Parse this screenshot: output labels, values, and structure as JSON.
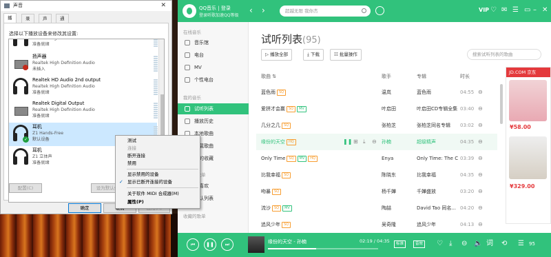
{
  "sound_dialog": {
    "title": "声音",
    "close": "✕",
    "tabs": [
      "播放",
      "录制",
      "声音",
      "通信"
    ],
    "hint": "选择以下播放设备来修改其设置:",
    "devices": [
      {
        "name": "",
        "sub": "Realtek High Definition Audio",
        "status": "准备就绪"
      },
      {
        "name": "扬声器",
        "sub": "Realtek High Definition Audio",
        "status": "未插入"
      },
      {
        "name": "Realtek HD Audio 2nd output",
        "sub": "Realtek High Definition Audio",
        "status": "准备就绪"
      },
      {
        "name": "Realtek Digital Output",
        "sub": "Realtek High Definition Audio",
        "status": "准备就绪"
      },
      {
        "name": "耳机",
        "sub": "Z1 Hands-Free",
        "status": "默认设备"
      },
      {
        "name": "耳机",
        "sub": "Z1 立体声",
        "status": "准备就绪"
      }
    ],
    "buttons": {
      "configure": "配置(C)",
      "set_default": "设为默认值",
      "ok": "确定",
      "cancel": "取消",
      "apply": "应用(A)"
    },
    "context_menu": [
      "测试",
      "连接",
      "断开连接",
      "禁用",
      "显示禁用的设备",
      "显示已断开连接的设备",
      "关于软件 MIDI 合成器(M)",
      "属性(P)"
    ],
    "check": "✓"
  },
  "qq": {
    "app_name": "QQ音乐 | 登录",
    "app_sub": "登录听歌加速QQ等级",
    "search_placeholder": "超越无限 我你杰",
    "vip": "VIP",
    "nav_back": "‹",
    "nav_fwd": "›",
    "sidebar": {
      "online_head": "在线音乐",
      "online": [
        "音乐馆",
        "电台",
        "MV",
        "个性电台"
      ],
      "mine_head": "我的音乐",
      "mine": [
        "试听列表",
        "播放历史",
        "本地歌曲",
        "下载歌曲",
        "我的收藏"
      ],
      "created_head": "创建的歌单",
      "created": [
        "我喜欢",
        "默认列表"
      ],
      "fav_head": "收藏的歌单"
    },
    "list_title": "试听列表",
    "list_count": "(95)",
    "buttons": {
      "play_all": "播放全部",
      "download": "下载",
      "batch": "批量操作"
    },
    "search_list": "搜索试听列表的歌曲",
    "columns": [
      "歌曲",
      "歌手",
      "专辑",
      "时长"
    ],
    "songs": [
      {
        "title": "蓝色雨",
        "tags": [
          "SQ"
        ],
        "singer": "温岚",
        "album": "蓝色雨",
        "time": "04:55"
      },
      {
        "title": "爱拼才会赢",
        "tags": [
          "SQ",
          "MV"
        ],
        "singer": "叶启田",
        "album": "叶启田CD专辑全集",
        "time": "03:40"
      },
      {
        "title": "几分之几",
        "tags": [
          "SQ"
        ],
        "singer": "张柏芝",
        "album": "张柏芝同名专辑",
        "time": "03:02"
      },
      {
        "title": "缘份的天空",
        "tags": [
          "HQ"
        ],
        "singer": "孙楠",
        "album": "超级精声",
        "time": "04:35"
      },
      {
        "title": "Only Time",
        "tags": [
          "SQ",
          "MV",
          "HQ"
        ],
        "singer": "Enya",
        "album": "Only Time: The C...",
        "time": "03:39"
      },
      {
        "title": "比我幸福",
        "tags": [
          "SQ"
        ],
        "singer": "陈晓东",
        "album": "比我幸福",
        "time": "04:35"
      },
      {
        "title": "吻暴",
        "tags": [
          "SQ"
        ],
        "singer": "杨千嬅",
        "album": "千嬅盛放",
        "time": "03:20"
      },
      {
        "title": "流沙",
        "tags": [
          "SQ",
          "MV"
        ],
        "singer": "陶喆",
        "album": "David Tao 同名...",
        "time": "04:20"
      },
      {
        "title": "追风少年",
        "tags": [
          "SQ"
        ],
        "singer": "吴奇隆",
        "album": "追风少年",
        "time": "04:13"
      }
    ],
    "ad": {
      "brand": "JD.COM 京东",
      "price1": "¥58.00",
      "price2": "¥329.00"
    },
    "player": {
      "song": "缘份的天空",
      "singer": "孙楠",
      "time": "02:19 / 04:35",
      "quality": "标准",
      "effect": "音效",
      "count": "95"
    }
  }
}
